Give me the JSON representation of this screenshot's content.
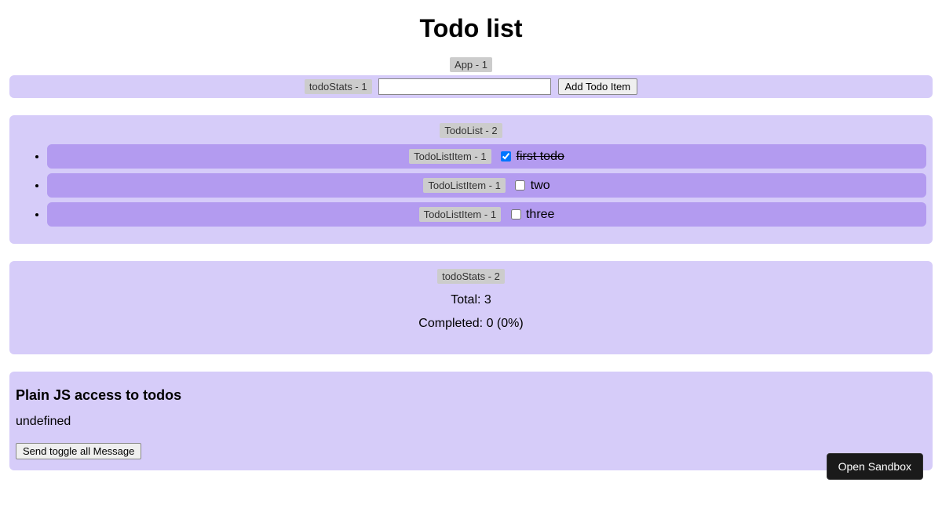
{
  "title": "Todo list",
  "app_tag": "App - 1",
  "inputbar": {
    "tag": "todoStats - 1",
    "input_value": "",
    "add_button": "Add Todo Item"
  },
  "list": {
    "tag": "TodoList - 2",
    "items": [
      {
        "tag": "TodoListItem - 1",
        "checked": true,
        "text": "first todo"
      },
      {
        "tag": "TodoListItem - 1",
        "checked": false,
        "text": "two"
      },
      {
        "tag": "TodoListItem - 1",
        "checked": false,
        "text": "three"
      }
    ]
  },
  "stats": {
    "tag": "todoStats - 2",
    "total_line": "Total: 3",
    "completed_line": "Completed: 0 (0%)"
  },
  "plainjs": {
    "heading": "Plain JS access to todos",
    "value_text": "undefined",
    "button": "Send toggle all Message"
  },
  "sandbox_button": "Open Sandbox"
}
